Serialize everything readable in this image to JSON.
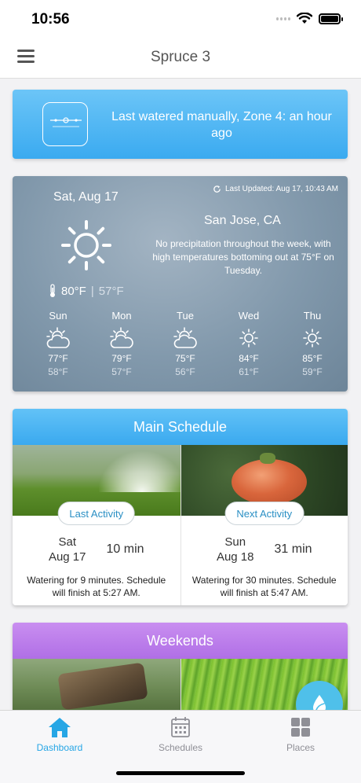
{
  "status_bar": {
    "time": "10:56"
  },
  "nav": {
    "title": "Spruce 3"
  },
  "banner": {
    "message": "Last watered manually, Zone 4: an hour ago",
    "device_label": "spruce"
  },
  "weather": {
    "date": "Sat, Aug 17",
    "last_updated": "Last Updated: Aug 17, 10:43 AM",
    "city": "San Jose, CA",
    "description": "No precipitation throughout the week, with high temperatures bottoming out at 75°F on Tuesday.",
    "high": "80°F",
    "separator": "|",
    "low": "57°F",
    "forecast": [
      {
        "day": "Sun",
        "icon": "partly-cloudy-icon",
        "high": "77°F",
        "low": "58°F"
      },
      {
        "day": "Mon",
        "icon": "partly-cloudy-icon",
        "high": "79°F",
        "low": "57°F"
      },
      {
        "day": "Tue",
        "icon": "partly-cloudy-icon",
        "high": "75°F",
        "low": "56°F"
      },
      {
        "day": "Wed",
        "icon": "sun-icon",
        "high": "84°F",
        "low": "61°F"
      },
      {
        "day": "Thu",
        "icon": "sun-icon",
        "high": "85°F",
        "low": "59°F"
      }
    ]
  },
  "main_schedule": {
    "title": "Main Schedule",
    "last_activity": {
      "button": "Last Activity",
      "day": "Sat",
      "date": "Aug 17",
      "duration": "10 min",
      "note": "Watering for 9 minutes. Schedule will finish at 5:27 AM."
    },
    "next_activity": {
      "button": "Next Activity",
      "day": "Sun",
      "date": "Aug 18",
      "duration": "31 min",
      "note": "Watering for 30 minutes. Schedule will finish at 5:47 AM."
    }
  },
  "weekends_schedule": {
    "title": "Weekends"
  },
  "tabs": [
    {
      "label": "Dashboard",
      "icon": "home-icon",
      "active": true
    },
    {
      "label": "Schedules",
      "icon": "calendar-icon",
      "active": false
    },
    {
      "label": "Places",
      "icon": "grid-icon",
      "active": false
    }
  ],
  "colors": {
    "accent": "#26a6e5",
    "banner": "#3aaaf0",
    "weekends": "#b06fe6",
    "fab": "#4fc0ea"
  }
}
